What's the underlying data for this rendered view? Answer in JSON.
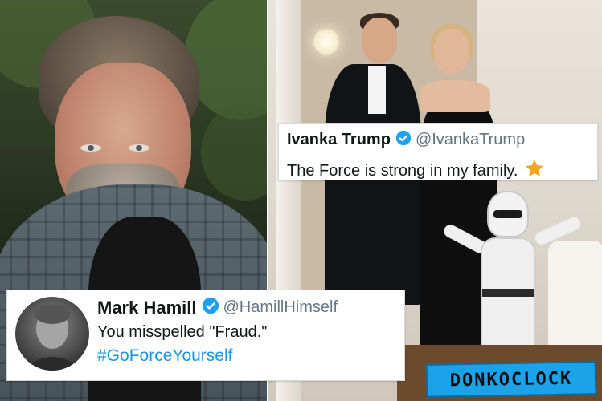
{
  "left_photo": {
    "subject": "man with grey beard in plaid shirt"
  },
  "right_photo": {
    "subject": "couple in formal wear with child in stormtrooper costume"
  },
  "ivanka_tweet": {
    "display_name": "Ivanka Trump",
    "handle": "@IvankaTrump",
    "text": "The Force is strong in my family.",
    "verified_icon": "verified-badge-icon",
    "emoji_icon": "star-icon"
  },
  "hamill_tweet": {
    "display_name": "Mark Hamill",
    "handle": "@HamillHimself",
    "text": "You misspelled \"Fraud.\"",
    "hashtag": "#GoForceYourself",
    "verified_icon": "verified-badge-icon"
  },
  "watermark": {
    "text": "DONKOCLOCK"
  },
  "colors": {
    "verified_blue": "#1da1f2",
    "hashtag_blue": "#1b95e0",
    "star_orange": "#f4a623",
    "watermark_bg": "#1aa3e8"
  }
}
